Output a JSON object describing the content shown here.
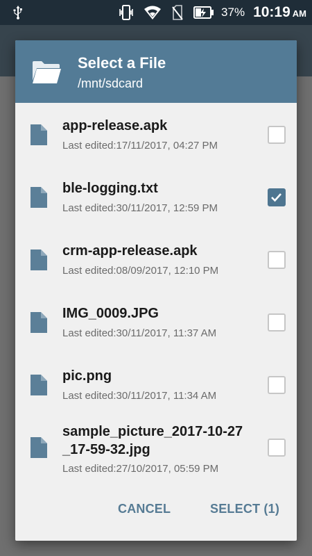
{
  "status_bar": {
    "usb_icon": "usb-icon",
    "vibrate_icon": "vibrate-icon",
    "wifi_icon": "wifi-icon",
    "signal_icon": "no-signal-icon",
    "battery_icon": "battery-charging-icon",
    "battery": "37%",
    "time": "10:19",
    "ampm": "AM"
  },
  "dialog": {
    "icon": "folder-icon",
    "title": "Select a File",
    "path": "/mnt/sdcard",
    "files": [
      {
        "name": "app-release.apk",
        "date": "Last edited:17/11/2017, 04:27 PM",
        "checked": false
      },
      {
        "name": "ble-logging.txt",
        "date": "Last edited:30/11/2017, 12:59 PM",
        "checked": true
      },
      {
        "name": "crm-app-release.apk",
        "date": "Last edited:08/09/2017, 12:10 PM",
        "checked": false
      },
      {
        "name": "IMG_0009.JPG",
        "date": "Last edited:30/11/2017, 11:37 AM",
        "checked": false
      },
      {
        "name": "pic.png",
        "date": "Last edited:30/11/2017, 11:34 AM",
        "checked": false
      },
      {
        "name": "sample_picture_2017-10-27_17-59-32.jpg",
        "date": "Last edited:27/10/2017, 05:59 PM",
        "checked": false
      }
    ],
    "cancel_label": "CANCEL",
    "select_label": "SELECT (1)"
  },
  "colors": {
    "header": "#537b96",
    "accent": "#567b94",
    "checkbox_checked": "#4e7590",
    "status_bar": "#1f2d38"
  }
}
